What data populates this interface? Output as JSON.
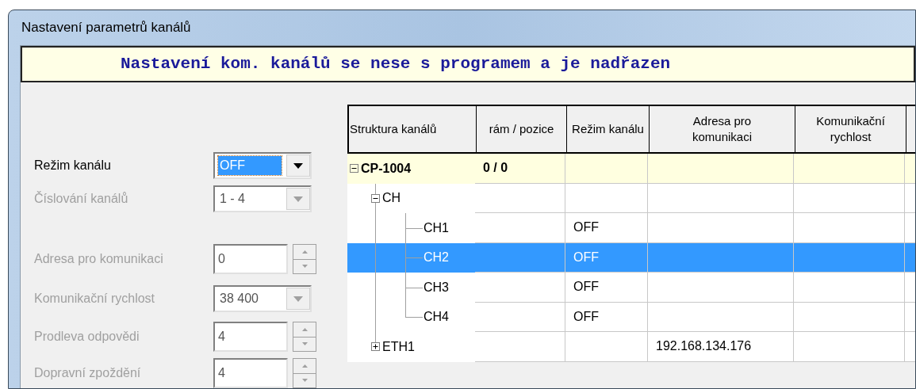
{
  "window": {
    "title": "Nastavení parametrů kanálů"
  },
  "banner": "Nastavení kom. kanálů se nese s programem a je nadřazen",
  "fields": [
    {
      "kind": "combo",
      "label": "Režim kanálu",
      "value": "OFF",
      "disabled": false,
      "focused": true
    },
    {
      "kind": "combo",
      "label": "Číslování kanálů",
      "value": "1 - 4",
      "disabled": true,
      "focused": false
    },
    {
      "kind": "spin",
      "label": "Adresa pro komunikaci",
      "value": "0",
      "disabled": true,
      "focused": false
    },
    {
      "kind": "combo",
      "label": "Komunikační rychlost",
      "value": "38 400",
      "disabled": true,
      "focused": false
    },
    {
      "kind": "spin",
      "label": "Prodleva odpovědi",
      "value": "4",
      "disabled": true,
      "focused": false
    },
    {
      "kind": "spin",
      "label": "Dopravní zpoždění",
      "value": "4",
      "disabled": true,
      "focused": false
    }
  ],
  "grid": {
    "columns": [
      "Struktura kanálů",
      "rám / pozice",
      "Režim kanálu",
      "Adresa pro komunikaci",
      "Komunikační rychlost"
    ],
    "rows": [
      {
        "kind": "device",
        "label": "CP-1004",
        "expanded": true,
        "selected": false,
        "position": "0 / 0",
        "children": [
          {
            "kind": "group",
            "label": "CH",
            "expanded": true,
            "selected": false,
            "children": [
              {
                "kind": "channel",
                "label": "CH1",
                "selected": false,
                "mode": "OFF"
              },
              {
                "kind": "channel",
                "label": "CH2",
                "selected": true,
                "mode": "OFF"
              },
              {
                "kind": "channel",
                "label": "CH3",
                "selected": false,
                "mode": "OFF"
              },
              {
                "kind": "channel",
                "label": "CH4",
                "selected": false,
                "mode": "OFF"
              }
            ]
          },
          {
            "kind": "group",
            "label": "ETH1",
            "expanded": false,
            "selected": false,
            "address": "192.168.134.176"
          }
        ]
      }
    ]
  }
}
